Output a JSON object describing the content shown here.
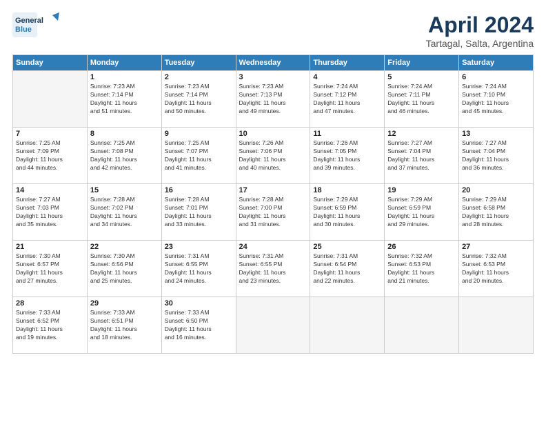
{
  "logo": {
    "line1": "General",
    "line2": "Blue"
  },
  "title": "April 2024",
  "subtitle": "Tartagal, Salta, Argentina",
  "headers": [
    "Sunday",
    "Monday",
    "Tuesday",
    "Wednesday",
    "Thursday",
    "Friday",
    "Saturday"
  ],
  "weeks": [
    [
      {
        "day": "",
        "info": ""
      },
      {
        "day": "1",
        "info": "Sunrise: 7:23 AM\nSunset: 7:14 PM\nDaylight: 11 hours\nand 51 minutes."
      },
      {
        "day": "2",
        "info": "Sunrise: 7:23 AM\nSunset: 7:14 PM\nDaylight: 11 hours\nand 50 minutes."
      },
      {
        "day": "3",
        "info": "Sunrise: 7:23 AM\nSunset: 7:13 PM\nDaylight: 11 hours\nand 49 minutes."
      },
      {
        "day": "4",
        "info": "Sunrise: 7:24 AM\nSunset: 7:12 PM\nDaylight: 11 hours\nand 47 minutes."
      },
      {
        "day": "5",
        "info": "Sunrise: 7:24 AM\nSunset: 7:11 PM\nDaylight: 11 hours\nand 46 minutes."
      },
      {
        "day": "6",
        "info": "Sunrise: 7:24 AM\nSunset: 7:10 PM\nDaylight: 11 hours\nand 45 minutes."
      }
    ],
    [
      {
        "day": "7",
        "info": "Sunrise: 7:25 AM\nSunset: 7:09 PM\nDaylight: 11 hours\nand 44 minutes."
      },
      {
        "day": "8",
        "info": "Sunrise: 7:25 AM\nSunset: 7:08 PM\nDaylight: 11 hours\nand 42 minutes."
      },
      {
        "day": "9",
        "info": "Sunrise: 7:25 AM\nSunset: 7:07 PM\nDaylight: 11 hours\nand 41 minutes."
      },
      {
        "day": "10",
        "info": "Sunrise: 7:26 AM\nSunset: 7:06 PM\nDaylight: 11 hours\nand 40 minutes."
      },
      {
        "day": "11",
        "info": "Sunrise: 7:26 AM\nSunset: 7:05 PM\nDaylight: 11 hours\nand 39 minutes."
      },
      {
        "day": "12",
        "info": "Sunrise: 7:27 AM\nSunset: 7:04 PM\nDaylight: 11 hours\nand 37 minutes."
      },
      {
        "day": "13",
        "info": "Sunrise: 7:27 AM\nSunset: 7:04 PM\nDaylight: 11 hours\nand 36 minutes."
      }
    ],
    [
      {
        "day": "14",
        "info": "Sunrise: 7:27 AM\nSunset: 7:03 PM\nDaylight: 11 hours\nand 35 minutes."
      },
      {
        "day": "15",
        "info": "Sunrise: 7:28 AM\nSunset: 7:02 PM\nDaylight: 11 hours\nand 34 minutes."
      },
      {
        "day": "16",
        "info": "Sunrise: 7:28 AM\nSunset: 7:01 PM\nDaylight: 11 hours\nand 33 minutes."
      },
      {
        "day": "17",
        "info": "Sunrise: 7:28 AM\nSunset: 7:00 PM\nDaylight: 11 hours\nand 31 minutes."
      },
      {
        "day": "18",
        "info": "Sunrise: 7:29 AM\nSunset: 6:59 PM\nDaylight: 11 hours\nand 30 minutes."
      },
      {
        "day": "19",
        "info": "Sunrise: 7:29 AM\nSunset: 6:59 PM\nDaylight: 11 hours\nand 29 minutes."
      },
      {
        "day": "20",
        "info": "Sunrise: 7:29 AM\nSunset: 6:58 PM\nDaylight: 11 hours\nand 28 minutes."
      }
    ],
    [
      {
        "day": "21",
        "info": "Sunrise: 7:30 AM\nSunset: 6:57 PM\nDaylight: 11 hours\nand 27 minutes."
      },
      {
        "day": "22",
        "info": "Sunrise: 7:30 AM\nSunset: 6:56 PM\nDaylight: 11 hours\nand 25 minutes."
      },
      {
        "day": "23",
        "info": "Sunrise: 7:31 AM\nSunset: 6:55 PM\nDaylight: 11 hours\nand 24 minutes."
      },
      {
        "day": "24",
        "info": "Sunrise: 7:31 AM\nSunset: 6:55 PM\nDaylight: 11 hours\nand 23 minutes."
      },
      {
        "day": "25",
        "info": "Sunrise: 7:31 AM\nSunset: 6:54 PM\nDaylight: 11 hours\nand 22 minutes."
      },
      {
        "day": "26",
        "info": "Sunrise: 7:32 AM\nSunset: 6:53 PM\nDaylight: 11 hours\nand 21 minutes."
      },
      {
        "day": "27",
        "info": "Sunrise: 7:32 AM\nSunset: 6:53 PM\nDaylight: 11 hours\nand 20 minutes."
      }
    ],
    [
      {
        "day": "28",
        "info": "Sunrise: 7:33 AM\nSunset: 6:52 PM\nDaylight: 11 hours\nand 19 minutes."
      },
      {
        "day": "29",
        "info": "Sunrise: 7:33 AM\nSunset: 6:51 PM\nDaylight: 11 hours\nand 18 minutes."
      },
      {
        "day": "30",
        "info": "Sunrise: 7:33 AM\nSunset: 6:50 PM\nDaylight: 11 hours\nand 16 minutes."
      },
      {
        "day": "",
        "info": ""
      },
      {
        "day": "",
        "info": ""
      },
      {
        "day": "",
        "info": ""
      },
      {
        "day": "",
        "info": ""
      }
    ]
  ]
}
